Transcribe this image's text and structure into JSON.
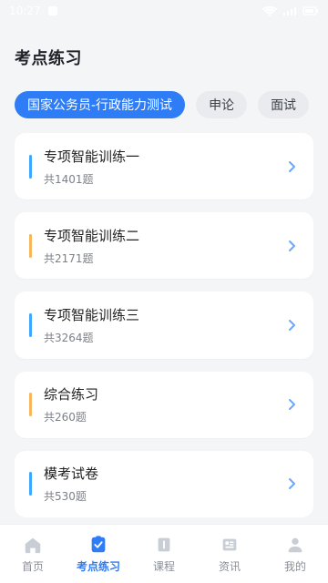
{
  "status": {
    "time": "10:27"
  },
  "header": {
    "title": "考点练习"
  },
  "tabs": [
    {
      "label": "国家公务员-行政能力测试",
      "active": true
    },
    {
      "label": "申论",
      "active": false
    },
    {
      "label": "面试",
      "active": false
    }
  ],
  "cards": [
    {
      "title": "专项智能训练一",
      "count": "共1401题",
      "accent": "#3da8ff"
    },
    {
      "title": "专项智能训练二",
      "count": "共2171题",
      "accent": "#f7b55c"
    },
    {
      "title": "专项智能训练三",
      "count": "共3264题",
      "accent": "#3da8ff"
    },
    {
      "title": "综合练习",
      "count": "共260题",
      "accent": "#f7b55c"
    },
    {
      "title": "模考试卷",
      "count": "共530题",
      "accent": "#3da8ff"
    }
  ],
  "nav": [
    {
      "label": "首页",
      "icon": "home-icon",
      "active": false
    },
    {
      "label": "考点练习",
      "icon": "practice-icon",
      "active": true
    },
    {
      "label": "课程",
      "icon": "course-icon",
      "active": false
    },
    {
      "label": "资讯",
      "icon": "news-icon",
      "active": false
    },
    {
      "label": "我的",
      "icon": "profile-icon",
      "active": false
    }
  ],
  "colors": {
    "primary": "#2e7cf6",
    "chevron": "#6aa7ff"
  }
}
